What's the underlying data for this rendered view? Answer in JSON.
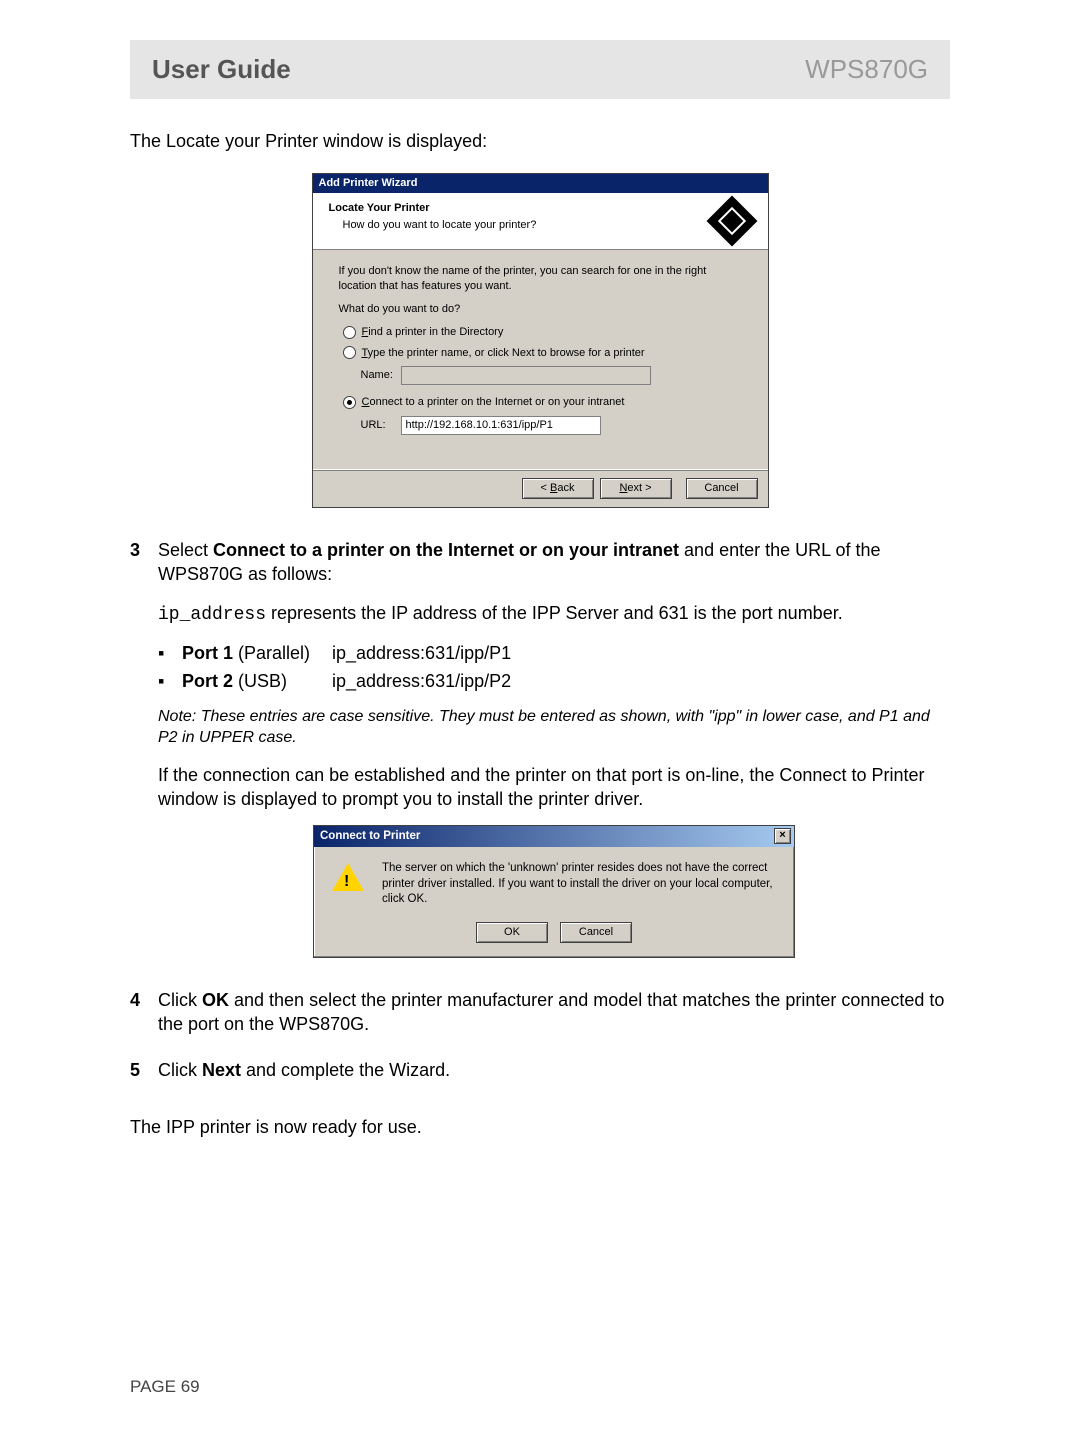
{
  "header": {
    "left": "User Guide",
    "right": "WPS870G"
  },
  "intro": "The Locate your Printer window is displayed:",
  "wizard": {
    "title": "Add Printer Wizard",
    "head_title": "Locate Your Printer",
    "head_sub": "How do you want to locate your printer?",
    "note_text": "If you don't know the name of the printer, you can search for one in the right location that has features you want.",
    "prompt": "What do you want to do?",
    "opt1_pre": "F",
    "opt1_rest": "ind a printer in the Directory",
    "opt2_pre": "T",
    "opt2_rest": "ype the printer name, or click Next to browse for a printer",
    "name_label": "Name:",
    "opt3_pre": "C",
    "opt3_rest": "onnect to a printer on the Internet or on your intranet",
    "url_label": "URL:",
    "url_value": "http://192.168.10.1:631/ipp/P1",
    "btn_back_pre": "< ",
    "btn_back_u": "B",
    "btn_back_rest": "ack",
    "btn_next_u": "N",
    "btn_next_rest": "ext >",
    "btn_cancel": "Cancel"
  },
  "step3": {
    "num": "3",
    "pre": "Select ",
    "bold": "Connect to a printer on the Internet or on your intranet",
    "post": " and enter the URL of the WPS870G as follows:",
    "ip_line_mono": "ip_address",
    "ip_line_rest": " represents the IP address of the IPP Server and 631 is the port number.",
    "port1_label_bold": "Port 1",
    "port1_label_rest": " (Parallel)",
    "port1_value": "ip_address:631/ipp/P1",
    "port2_label_bold": "Port 2",
    "port2_label_rest": " (USB)",
    "port2_value": "ip_address:631/ipp/P2",
    "note": "Note: These entries are case sensitive. They must be entered as shown, with \"ipp\" in lower case, and P1 and P2 in UPPER case.",
    "para2": "If the connection can be established and the printer on that port is on-line, the Connect to Printer window is displayed to prompt you to install the printer driver."
  },
  "dialog": {
    "title": "Connect to Printer",
    "close": "×",
    "text": "The server on which the 'unknown' printer resides does not have the correct printer driver installed. If you want to install the driver on your local computer, click OK.",
    "ok": "OK",
    "cancel": "Cancel"
  },
  "step4": {
    "num": "4",
    "pre": "Click ",
    "bold": "OK",
    "post": " and then select the printer manufacturer and model that matches the printer connected to the port on the WPS870G."
  },
  "step5": {
    "num": "5",
    "pre": "Click ",
    "bold": "Next",
    "post": " and complete the Wizard."
  },
  "closing": "The IPP printer is now ready for use.",
  "page_footer": "PAGE 69"
}
